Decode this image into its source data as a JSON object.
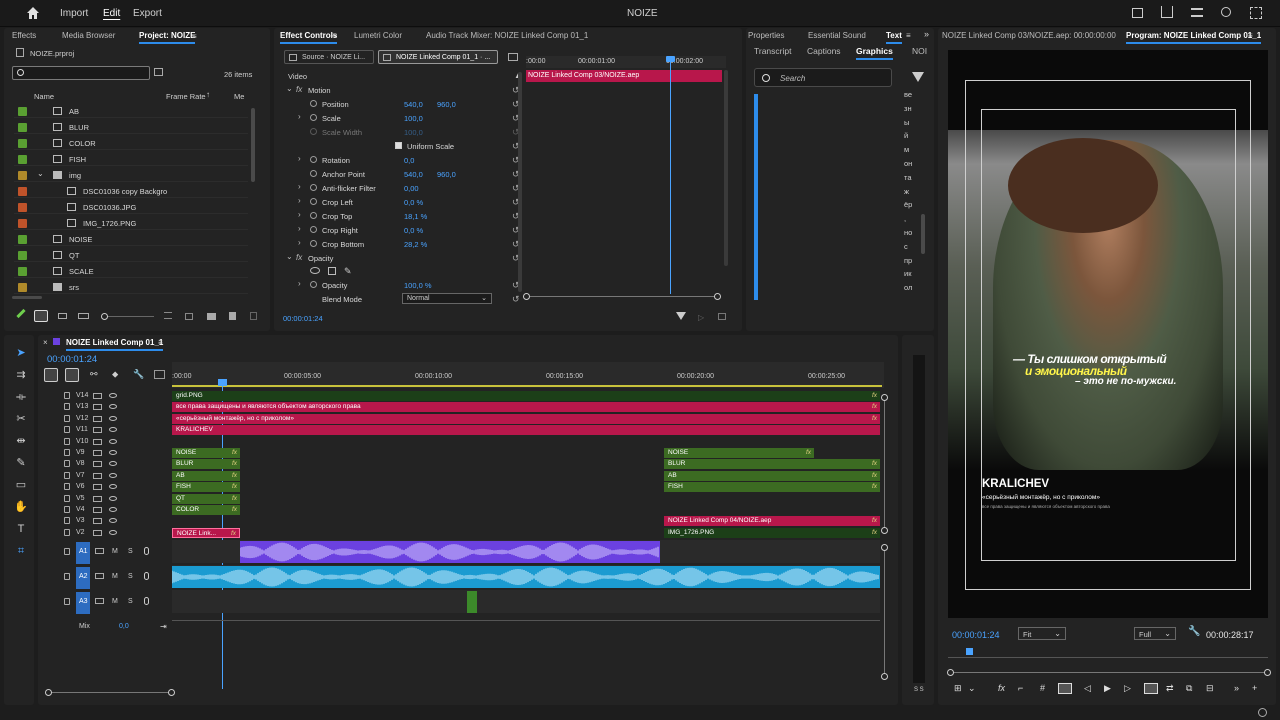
{
  "app": {
    "menu": [
      "Import",
      "Edit",
      "Export"
    ],
    "active_menu": "Edit",
    "title": "NOIZE"
  },
  "project": {
    "tabs": [
      "Effects",
      "Media Browser",
      "Project: NOIZE"
    ],
    "file": "NOIZE.prproj",
    "item_count": "26 items",
    "columns": [
      "Name",
      "Frame Rate",
      "Me"
    ],
    "items": [
      {
        "name": "AB",
        "color": "#5aa032"
      },
      {
        "name": "BLUR",
        "color": "#5aa032"
      },
      {
        "name": "COLOR",
        "color": "#5aa032"
      },
      {
        "name": "FISH",
        "color": "#5aa032"
      },
      {
        "name": "img",
        "color": "#b08a2a"
      },
      {
        "name": "DSC01036 copy Backgro",
        "color": "#c0532a"
      },
      {
        "name": "DSC01036.JPG",
        "color": "#c0532a"
      },
      {
        "name": "IMG_1726.PNG",
        "color": "#c0532a"
      },
      {
        "name": "NOISE",
        "color": "#5aa032"
      },
      {
        "name": "QT",
        "color": "#5aa032"
      },
      {
        "name": "SCALE",
        "color": "#5aa032"
      },
      {
        "name": "srs",
        "color": "#b08a2a"
      }
    ]
  },
  "effect_controls": {
    "tabs": [
      "Effect Controls",
      "Lumetri Color",
      "Audio Track Mixer: NOIZE Linked Comp 01_1"
    ],
    "subtabs": [
      "Source · NOIZE Li...",
      "NOIZE Linked Comp 01_1 · ..."
    ],
    "section": "Video",
    "motion": "Motion",
    "rows": [
      {
        "name": "Position",
        "v1": "540,0",
        "v2": "960,0"
      },
      {
        "name": "Scale",
        "v1": "100,0",
        "v2": ""
      },
      {
        "name": "Scale Width",
        "v1": "100,0",
        "v2": ""
      },
      {
        "name": "Uniform Scale",
        "v1": "",
        "v2": ""
      },
      {
        "name": "Rotation",
        "v1": "0,0",
        "v2": ""
      },
      {
        "name": "Anchor Point",
        "v1": "540,0",
        "v2": "960,0"
      },
      {
        "name": "Anti-flicker Filter",
        "v1": "0,00",
        "v2": ""
      },
      {
        "name": "Crop Left",
        "v1": "0,0 %",
        "v2": ""
      },
      {
        "name": "Crop Top",
        "v1": "18,1 %",
        "v2": ""
      },
      {
        "name": "Crop Right",
        "v1": "0,0 %",
        "v2": ""
      },
      {
        "name": "Crop Bottom",
        "v1": "28,2 %",
        "v2": ""
      }
    ],
    "opacity_section": "Opacity",
    "opacity": {
      "name": "Opacity",
      "v1": "100,0 %"
    },
    "blend": {
      "name": "Blend Mode",
      "value": "Normal"
    },
    "timecode": "00:00:01:24",
    "mini_ruler": [
      ":00:00",
      "00:00:01:00",
      "00:00:02:00"
    ],
    "clip": "NOIZE Linked Comp 03/NOIZE.aep"
  },
  "properties": {
    "tabs": [
      "Properties",
      "Essential Sound",
      "Text"
    ],
    "subtabs": [
      "Transcript",
      "Captions",
      "Graphics",
      "NOI"
    ],
    "search_placeholder": "Search",
    "side_text": [
      "ве",
      "зн",
      "ы",
      "й",
      "м",
      "он",
      "та",
      "ж",
      "ёр",
      ",",
      "но",
      "с",
      "пр",
      "ик",
      "ол"
    ]
  },
  "program": {
    "tabs": [
      "NOIZE Linked Comp 03/NOIZE.aep: 00:00:00:00",
      "Program: NOIZE Linked Comp 01_1"
    ],
    "timecode": "00:00:01:24",
    "fit": "Fit",
    "quality": "Full",
    "duration": "00:00:28:17",
    "overlay": {
      "line1": "— Ты слишком открытый",
      "line2": "и эмоциональный",
      "line3": "– это не по-мужски.",
      "name": "KRALICHEV",
      "sub": "«серьёзный монтажёр, но с приколом»",
      "small": "все права защищены и являются объектом авторского права"
    }
  },
  "timeline": {
    "tab": "NOIZE Linked Comp 01_1",
    "timecode": "00:00:01:24",
    "ruler": [
      ":00:00",
      "00:00:05:00",
      "00:00:10:00",
      "00:00:15:00",
      "00:00:20:00",
      "00:00:25:00"
    ],
    "video_tracks": [
      "V14",
      "V13",
      "V12",
      "V11",
      "V10",
      "V9",
      "V8",
      "V7",
      "V6",
      "V5",
      "V4",
      "V3",
      "V2"
    ],
    "audio_tracks": [
      "A1",
      "A2",
      "A3"
    ],
    "mix": {
      "label": "Mix",
      "value": "0,0"
    },
    "clips": {
      "v14": "grid.PNG",
      "v13": "все права защищены и являются объектом авторского права",
      "v12": "«серьёзный монтажёр, но с приколом»",
      "v11": "KRALICHEV",
      "left": [
        "NOISE",
        "BLUR",
        "AB",
        "FISH",
        "QT",
        "COLOR"
      ],
      "right": [
        "NOISE",
        "BLUR",
        "AB",
        "FISH"
      ],
      "v3_right": "NOIZE Linked Comp 04/NOIZE.aep",
      "v2_left": "NOIZE Link...",
      "v2_right": "IMG_1726.PNG"
    },
    "meter_label": "S S"
  },
  "colors": {
    "accent": "#2d8ceb",
    "pink": "#b8174b",
    "green": "#3c6b22",
    "purple": "#6b41e0",
    "cyan": "#1b9bd1"
  }
}
